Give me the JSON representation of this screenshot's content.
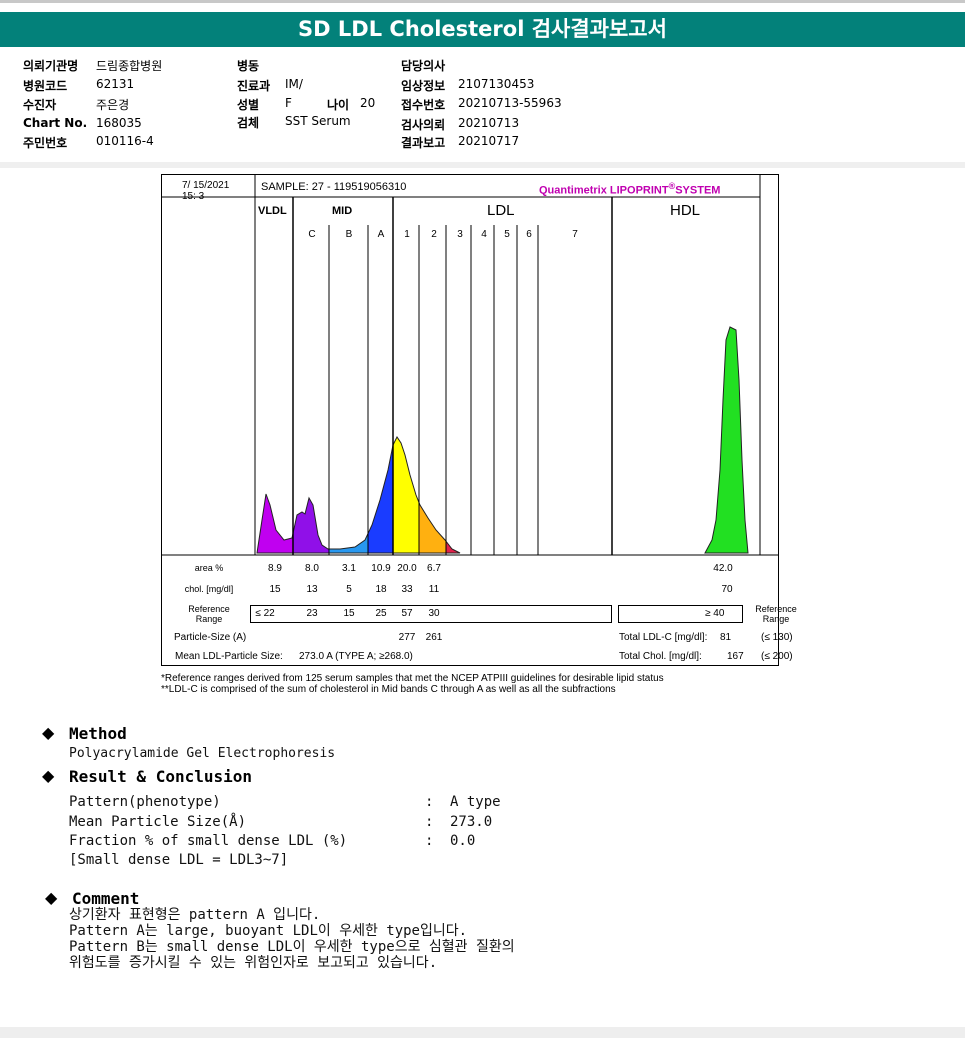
{
  "title": "SD LDL Cholesterol 검사결과보고서",
  "header": {
    "col1": [
      {
        "label": "의뢰기관명",
        "value": "드림종합병원"
      },
      {
        "label": "병원코드",
        "value": "62131"
      },
      {
        "label": "수진자",
        "value": "주은경"
      },
      {
        "label": "Chart No.",
        "value": "168035"
      },
      {
        "label": "주민번호",
        "value": "010116-4"
      }
    ],
    "col2": [
      {
        "label": "병동",
        "value": ""
      },
      {
        "label": "진료과",
        "value": "IM/"
      },
      {
        "label": "성별",
        "value": "F"
      },
      {
        "label": "검체",
        "value": "SST Serum"
      }
    ],
    "age_label": "나이",
    "age_value": "20",
    "col3": [
      {
        "label": "담당의사",
        "value": ""
      },
      {
        "label": "임상정보",
        "value": "2107130453"
      },
      {
        "label": "접수번호",
        "value": "20210713-55963"
      },
      {
        "label": "검사의뢰",
        "value": "20210713"
      },
      {
        "label": "결과보고",
        "value": "20210717"
      }
    ]
  },
  "chart": {
    "date": "7/ 15/2021",
    "time": "15:  3",
    "sample": "SAMPLE:    27 - 119519056310",
    "brand": "Quantimetrix LIPOPRINT",
    "brand_reg": "®",
    "brand_suffix": "SYSTEM",
    "groups": {
      "vldl": "VLDL",
      "mid": "MID",
      "ldl": "LDL",
      "hdl": "HDL"
    },
    "sub_labels": [
      "C",
      "B",
      "A",
      "1",
      "2",
      "3",
      "4",
      "5",
      "6",
      "7"
    ],
    "band_colors": {
      "VLDL": "#c000f0",
      "C": "#9010e8",
      "B": "#2898f0",
      "A": "#1a3cff",
      "LDL1": "#ffff00",
      "LDL2": "#ffb010",
      "LDL3": "#e0204a",
      "HDL": "#22e022"
    },
    "row_labels": {
      "area": "area %",
      "chol": "chol. [mg/dl]",
      "ref": [
        "Reference",
        "Range"
      ],
      "ref_right": [
        "Reference",
        "Range"
      ],
      "particle": "Particle-Size (A)",
      "mean": "Mean LDL-Particle Size:"
    },
    "area": [
      "8.9",
      "8.0",
      "3.1",
      "10.9",
      "20.0",
      "6.7"
    ],
    "area_hdl": "42.0",
    "chol": [
      "15",
      "13",
      "5",
      "18",
      "33",
      "11"
    ],
    "chol_hdl": "70",
    "ref": [
      "≤ 22",
      "23",
      "15",
      "25",
      "57",
      "30"
    ],
    "ref_hdl": "≥  40",
    "particle_sizes": [
      "277",
      "261"
    ],
    "mean_value": "273.0  A    (TYPE A; ≥268.0)",
    "total_ldl_label": "Total LDL-C [mg/dl]:",
    "total_ldl": "81",
    "total_ldl_ref": "(≤ 130)",
    "total_chol_label": "Total Chol. [mg/dl]:",
    "total_chol": "167",
    "total_chol_ref": "(≤ 200)",
    "footnote1": "*Reference ranges derived from 125 serum samples that met the NCEP ATPIII guidelines for desirable lipid status",
    "footnote2": "**LDL-C is comprised of the sum of cholesterol in Mid bands C through A as well as all the subfractions"
  },
  "method": {
    "heading": "Method",
    "text": "Polyacrylamide Gel Electrophoresis"
  },
  "result": {
    "heading": "Result & Conclusion",
    "rows": [
      {
        "label": "Pattern(phenotype)",
        "value": "A type"
      },
      {
        "label": "Mean Particle Size(Å)",
        "value": "273.0"
      },
      {
        "label": "Fraction % of small dense LDL (%)",
        "value": "0.0"
      }
    ],
    "note": "[Small dense LDL = LDL3~7]"
  },
  "comment": {
    "heading": "Comment",
    "lines": [
      "상기환자 표현형은 pattern A 입니다.",
      "Pattern A는 large, buoyant LDL이 우세한 type입니다.",
      "Pattern B는 small dense LDL이 우세한 type으로 심혈관 질환의",
      "위험도를 증가시킬 수 있는 위험인자로 보고되고 있습니다."
    ]
  }
}
